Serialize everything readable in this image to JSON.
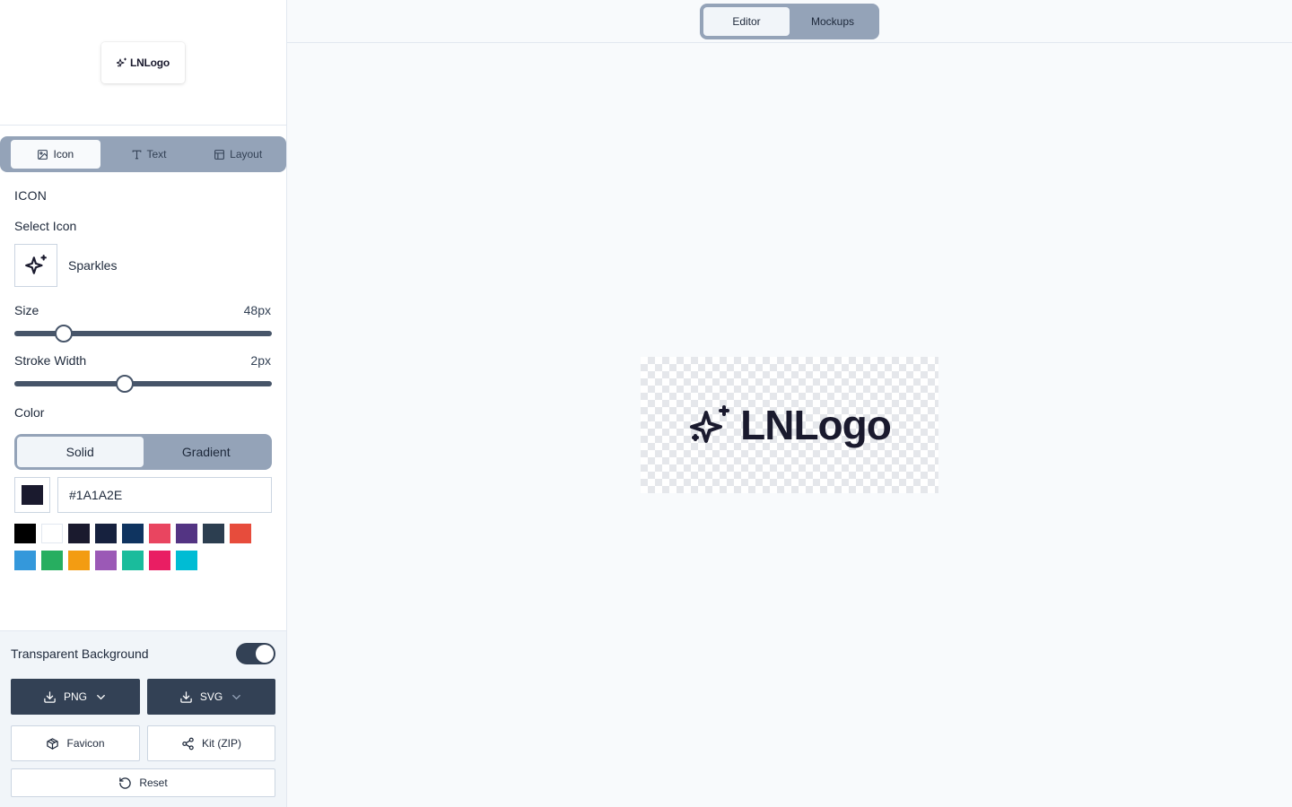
{
  "brand": {
    "name": "LNLogo",
    "color": "#1A1A2E"
  },
  "sidebar": {
    "tabs": [
      {
        "label": "Icon",
        "icon": "image-icon",
        "active": true
      },
      {
        "label": "Text",
        "icon": "type-icon",
        "active": false
      },
      {
        "label": "Layout",
        "icon": "layout-icon",
        "active": false
      }
    ],
    "section_title": "ICON",
    "select_icon_label": "Select Icon",
    "selected_icon": "Sparkles",
    "size": {
      "label": "Size",
      "value": "48px",
      "fraction": 0.19
    },
    "stroke": {
      "label": "Stroke Width",
      "value": "2px",
      "fraction": 0.43
    },
    "color": {
      "label": "Color",
      "modes": [
        "Solid",
        "Gradient"
      ],
      "active_mode": "Solid",
      "hex": "#1A1A2E",
      "palette_row1": [
        "#000000",
        "#FFFFFF",
        "#1A1A2E",
        "#16213E",
        "#0F3460",
        "#E94560",
        "#533483",
        "#2C3E50",
        "#E74C3C"
      ],
      "palette_row2": [
        "#3498DB",
        "#27AE60",
        "#F39C12",
        "#9B59B6",
        "#1ABC9C",
        "#E91E63",
        "#00BCD4"
      ]
    },
    "bottom": {
      "transparent_label": "Transparent Background",
      "transparent_on": true,
      "png_label": "PNG",
      "svg_label": "SVG",
      "favicon_label": "Favicon",
      "kit_label": "Kit (ZIP)",
      "reset_label": "Reset"
    }
  },
  "topbar": {
    "views": [
      "Editor",
      "Mockups"
    ],
    "active": "Editor"
  }
}
